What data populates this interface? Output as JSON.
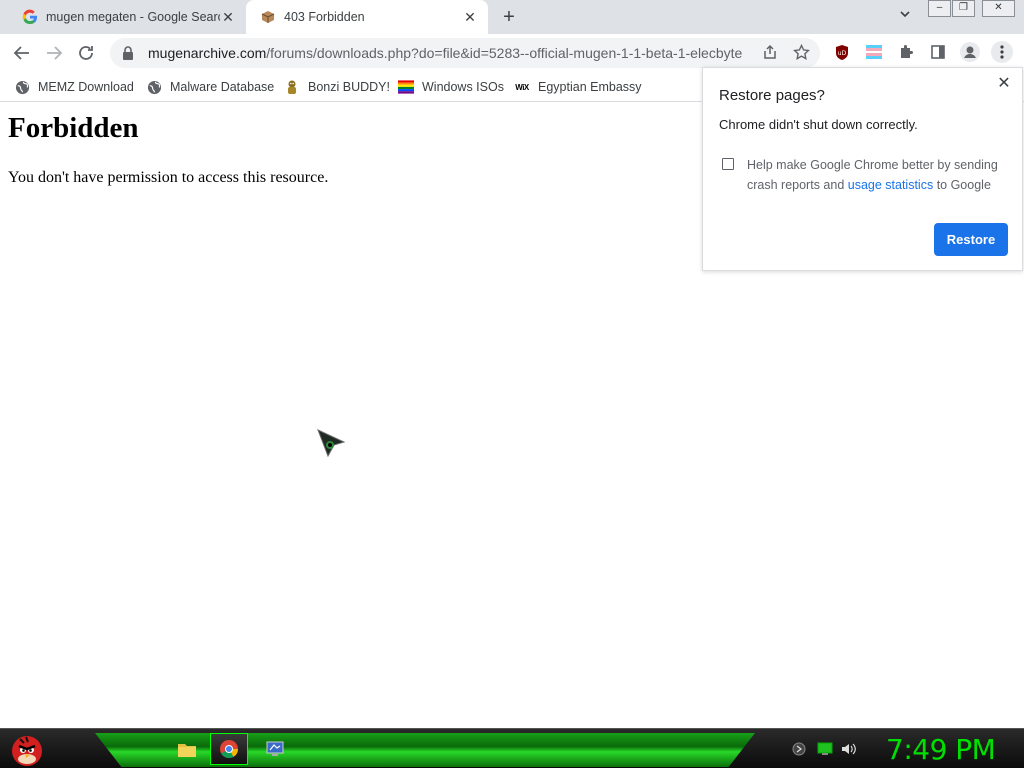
{
  "tabs": [
    {
      "title": "mugen megaten - Google Search",
      "favicon": "google-icon",
      "active": false
    },
    {
      "title": "403 Forbidden",
      "favicon": "box-icon",
      "active": true
    }
  ],
  "toolbar": {
    "url_host": "mugenarchive.com",
    "url_path": "/forums/downloads.php?do=file&id=5283--official-mugen-1-1-beta-1-elecbyte"
  },
  "bookmarks": [
    {
      "label": "MEMZ Download",
      "icon": "globe-icon"
    },
    {
      "label": "Malware Database",
      "icon": "globe-icon"
    },
    {
      "label": "Bonzi BUDDY!",
      "icon": "bonzi-icon"
    },
    {
      "label": "Windows ISOs",
      "icon": "rainbow-flag-icon"
    },
    {
      "label": "Egyptian Embassy",
      "icon": "wix-icon"
    }
  ],
  "page": {
    "heading": "Forbidden",
    "message": "You don't have permission to access this resource."
  },
  "popup": {
    "title": "Restore pages?",
    "message": "Chrome didn't shut down correctly.",
    "checkbox_text_before": "Help make Google Chrome better by sending crash reports and ",
    "checkbox_link": "usage statistics",
    "checkbox_text_after": " to Google",
    "restore_label": "Restore"
  },
  "bm_wix": "WiX",
  "ext_ublock": "uD",
  "taskbar": {
    "clock": "7:49 PM"
  },
  "colors": {
    "accent": "#1a73e8",
    "taskbar_green": "#18a018",
    "clock": "#00e000"
  }
}
